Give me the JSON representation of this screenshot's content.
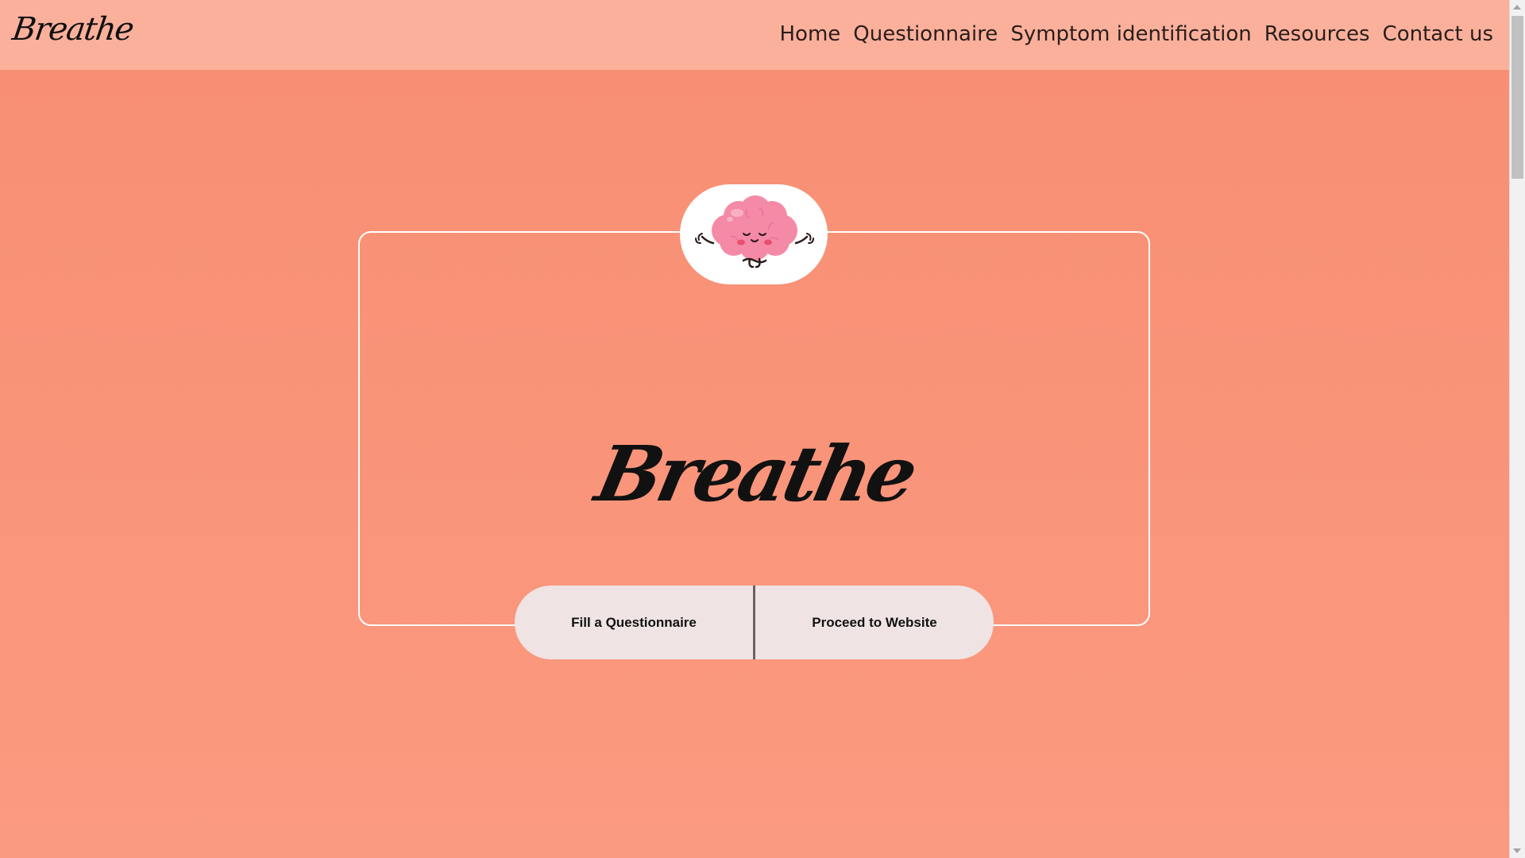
{
  "navbar": {
    "brand": "Breathe",
    "links": [
      {
        "label": "Home"
      },
      {
        "label": "Questionnaire"
      },
      {
        "label": "Symptom identification"
      },
      {
        "label": "Resources"
      },
      {
        "label": "Contact us"
      }
    ]
  },
  "hero": {
    "logo_icon": "meditating-brain-icon",
    "title": "Breathe",
    "buttons": {
      "questionnaire_label": "Fill a Questionnaire",
      "website_label": "Proceed to Website"
    }
  },
  "colors": {
    "navbar_bg": "#fbb09c",
    "page_bg": "#f88e72",
    "button_bg": "#efe3e3",
    "card_border": "#ffffff"
  }
}
